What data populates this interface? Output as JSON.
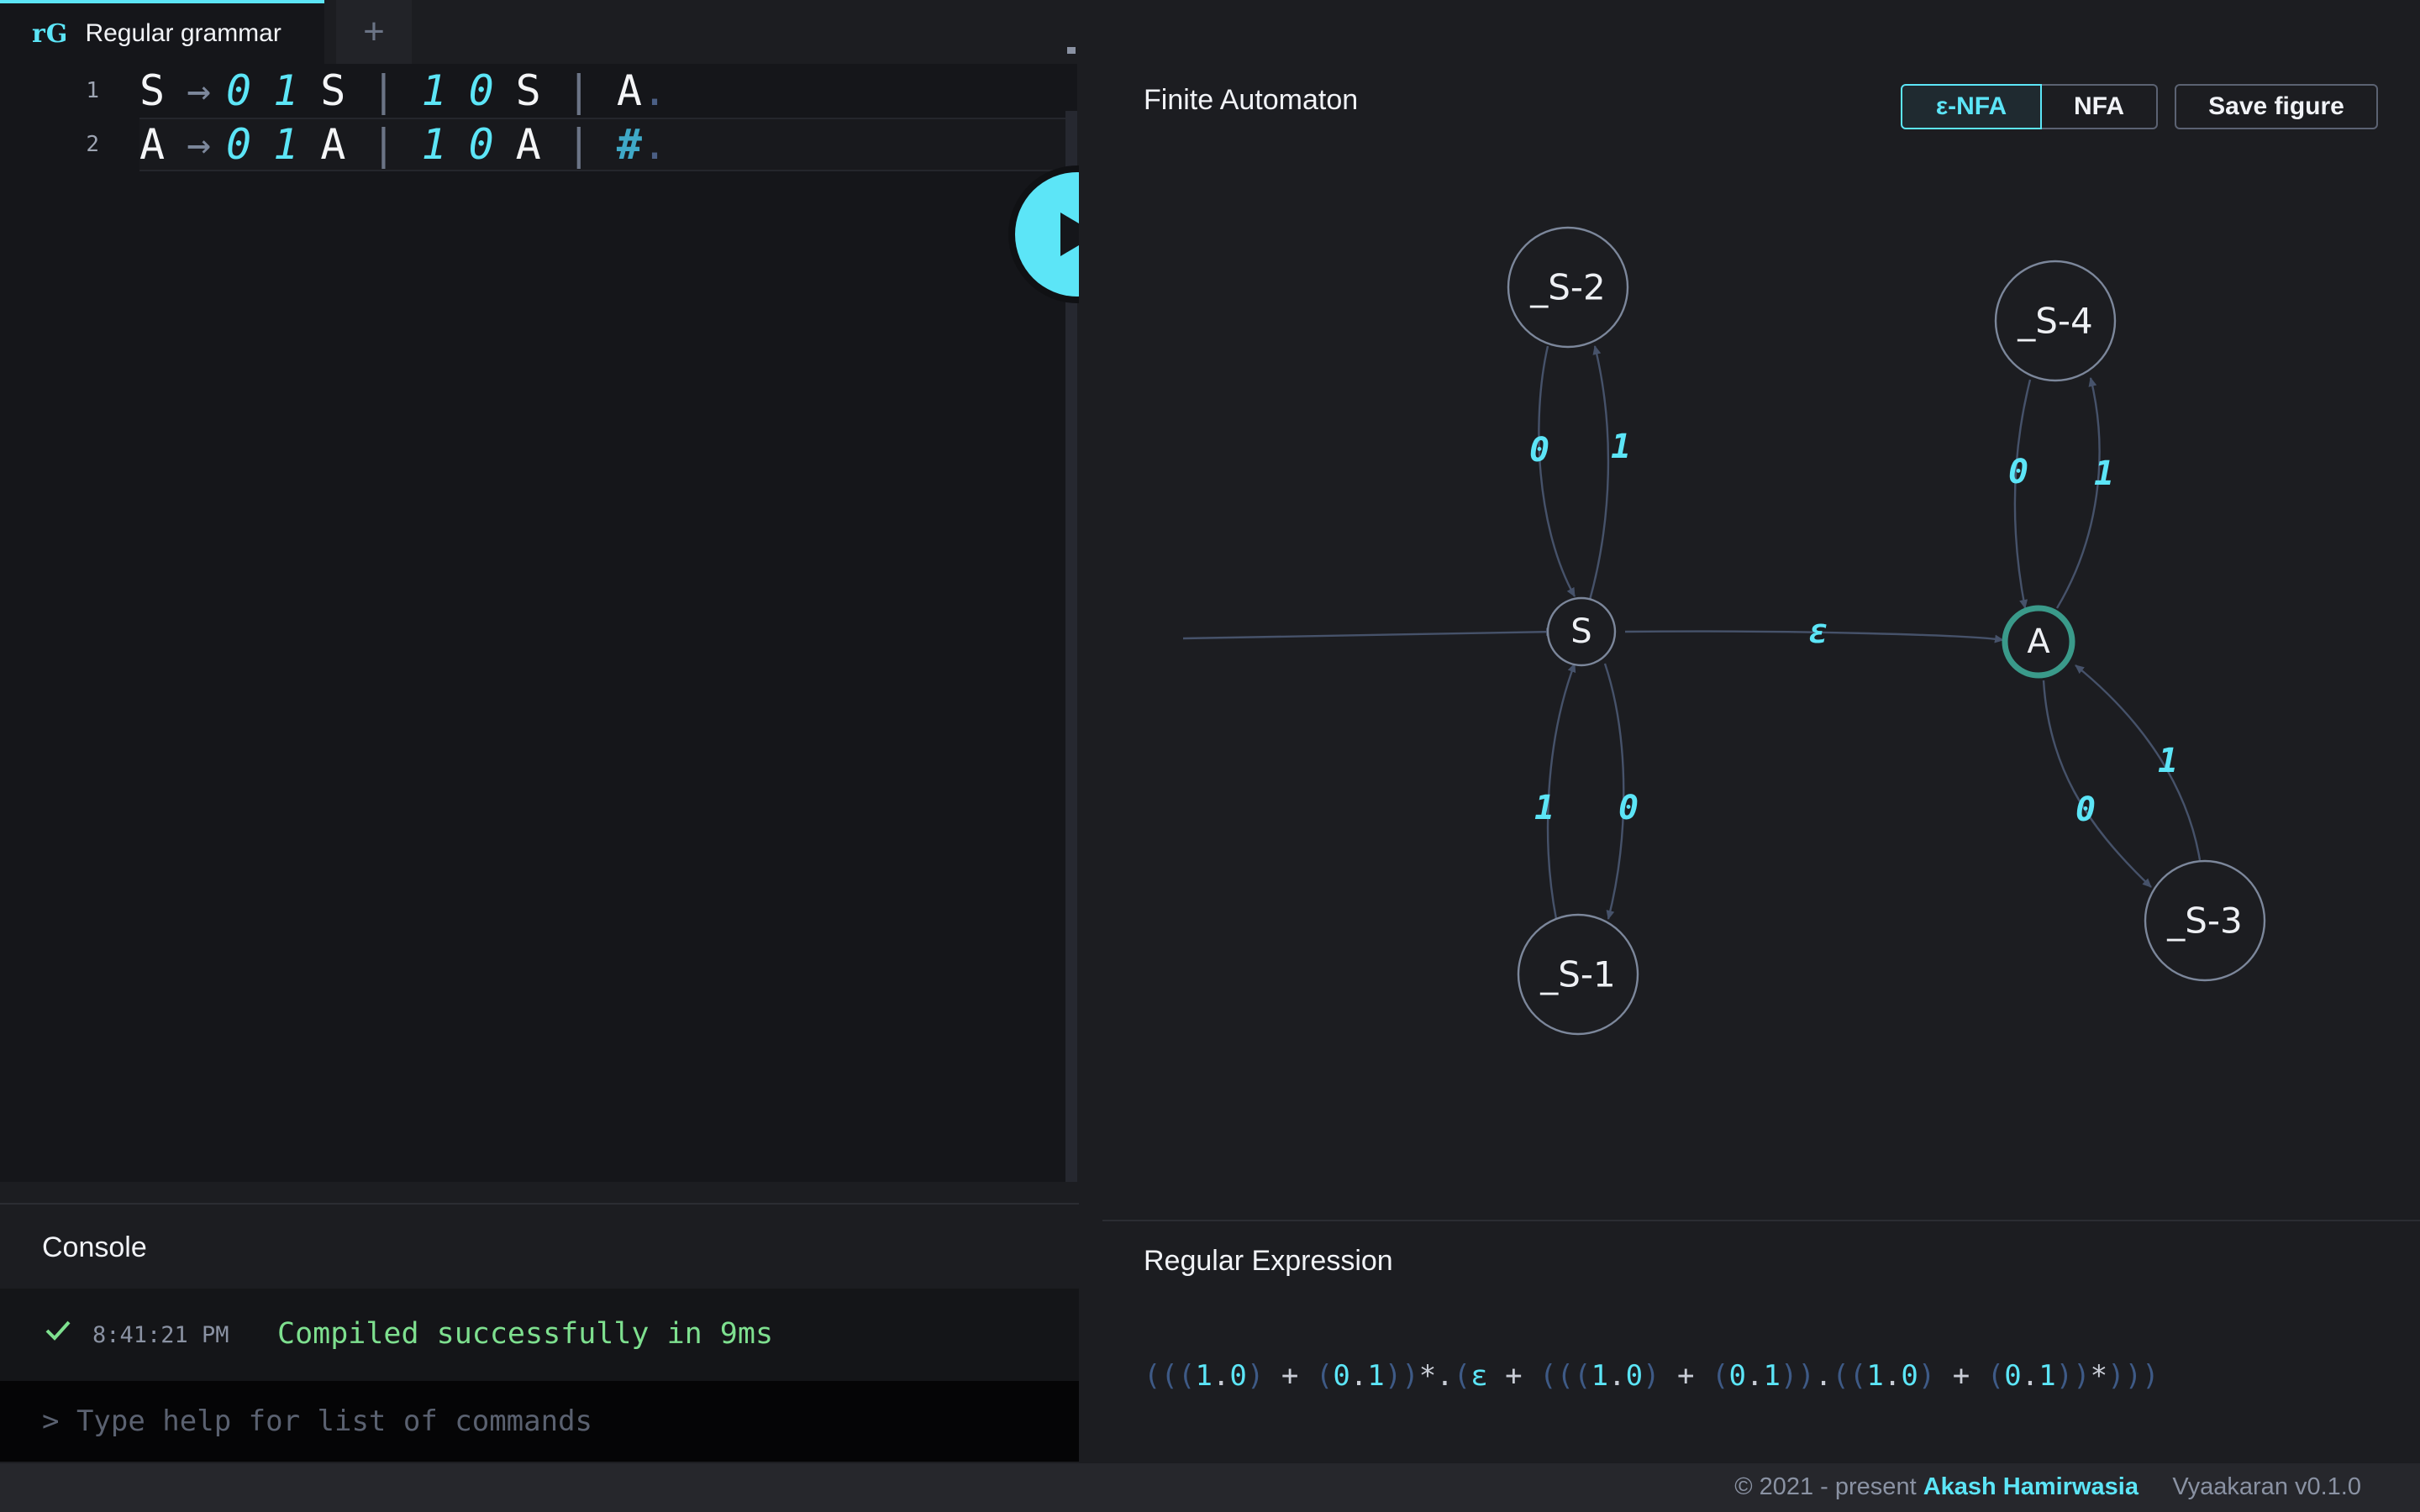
{
  "tabs": {
    "active_logo": "rG",
    "active_title": "Regular grammar",
    "add_label": "+"
  },
  "editor": {
    "lines": [
      {
        "number": "1",
        "lhs": "S",
        "arrow": "→",
        "alternatives": [
          [
            "0",
            "1",
            "S"
          ],
          [
            "1",
            "0",
            "S"
          ],
          [
            "A"
          ]
        ],
        "end": "."
      },
      {
        "number": "2",
        "lhs": "A",
        "arrow": "→",
        "alternatives": [
          [
            "0",
            "1",
            "A"
          ],
          [
            "1",
            "0",
            "A"
          ],
          [
            "#"
          ]
        ],
        "end": "."
      }
    ],
    "separator": "|"
  },
  "run_button": {
    "icon": "play-icon"
  },
  "automaton": {
    "title": "Finite Automaton",
    "buttons": {
      "enfa": "ε-NFA",
      "nfa": "NFA",
      "save": "Save figure"
    },
    "selected_mode": "ε-NFA",
    "states": [
      "S",
      "A",
      "_S-1",
      "_S-2",
      "_S-3",
      "_S-4"
    ],
    "start_state": "S",
    "accept_states": [
      "A"
    ],
    "transitions": [
      {
        "from": "S",
        "to": "_S-2",
        "label": "1"
      },
      {
        "from": "_S-2",
        "to": "S",
        "label": "0"
      },
      {
        "from": "S",
        "to": "_S-1",
        "label": "0"
      },
      {
        "from": "_S-1",
        "to": "S",
        "label": "1"
      },
      {
        "from": "S",
        "to": "A",
        "label": "ε"
      },
      {
        "from": "A",
        "to": "_S-4",
        "label": "1"
      },
      {
        "from": "_S-4",
        "to": "A",
        "label": "0"
      },
      {
        "from": "A",
        "to": "_S-3",
        "label": "0"
      },
      {
        "from": "_S-3",
        "to": "A",
        "label": "1"
      }
    ],
    "colors": {
      "edge": "#46526a",
      "label": "#5ce5f7",
      "accept": "#3a9a8a",
      "node": "#7c879b"
    }
  },
  "regex": {
    "title": "Regular Expression",
    "expression": "(((1.0) + (0.1))*.(ε + (((1.0) + (0.1)).((1.0) + (0.1))*)))"
  },
  "console": {
    "title": "Console",
    "log": {
      "time": "8:41:21 PM",
      "message": "Compiled successfully in 9ms",
      "status_icon": "check-icon"
    },
    "input_placeholder": "> Type help for list of commands"
  },
  "footer": {
    "copyright": "© 2021 - present ",
    "author": "Akash Hamirwasia",
    "version": "Vyaakaran v0.1.0"
  },
  "theme": {
    "accent": "#5ce5f7",
    "success": "#7ee08f",
    "background": "#1c1d21",
    "editor_bg": "#15161a"
  }
}
